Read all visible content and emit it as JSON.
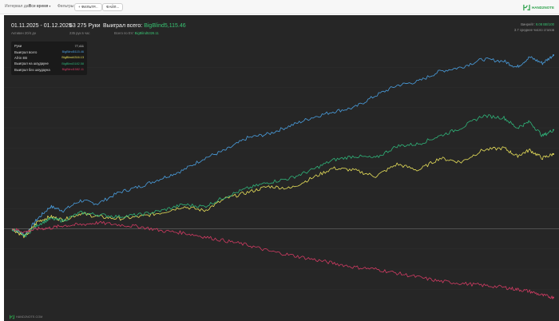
{
  "toolbar": {
    "interval_label": "Интервал дат:",
    "interval_value": "Все время",
    "filters_label": "Фильтры:",
    "filter_button": "+ ФИЛЬТР...",
    "file_button": "ФАЙЛ..."
  },
  "brand": {
    "name": "HAND2NOTE",
    "accent_color": "#2da14b"
  },
  "graph": {
    "date_range": "01.11.2025 - 01.12.2025",
    "active_days": "Активен 20/4 дн",
    "hands": "63 275 Руки",
    "hands_per_hour": "235 рук в час",
    "won_total_label": "Выиграл всего:",
    "won_total_value": "BigBlind5,115.46",
    "ev_label": "Всего по EV:",
    "ev_value": "BigBlind5326.11",
    "winrate_label": "Винрейт:",
    "winrate_value": "8.08 BB/100",
    "avg_tables": "3.7 среднее число столов",
    "footer_brand": "HAND2NOTE.COM"
  },
  "legend": {
    "rows": [
      {
        "label": "Руки",
        "value": "77,411",
        "color": "#dcdcdc"
      },
      {
        "label": "Выиграл всего",
        "value": "BigBlind5115.46",
        "color": "#4a9fe0"
      },
      {
        "label": "All-in EB",
        "value": "BigBlind4316.13",
        "color": "#e8e05a"
      },
      {
        "label": "Выиграл на шоудауне",
        "value": "BigBlind3182.58",
        "color": "#2fb57a"
      },
      {
        "label": "Выиграл без шоудауна",
        "value": "BigBlind1582.11",
        "color": "#d23b63"
      }
    ]
  },
  "chart_data": {
    "type": "line",
    "xlabel": "",
    "ylabel": "",
    "grid": true,
    "xlim": [
      0,
      63275
    ],
    "ylim": [
      -1800,
      4400
    ],
    "series": [
      {
        "name": "Выиграл всего",
        "color": "#4a9fe0",
        "x": [
          0,
          1500,
          3000,
          4500,
          6000,
          8000,
          10000,
          12500,
          15000,
          17500,
          20000,
          22500,
          25000,
          27500,
          30000,
          32500,
          35000,
          37500,
          40000,
          42500,
          45000,
          47500,
          50000,
          52500,
          55000,
          57500,
          59000,
          60500,
          62000,
          63275
        ],
        "y": [
          0,
          -150,
          250,
          550,
          450,
          700,
          620,
          900,
          1050,
          1250,
          1450,
          1750,
          1950,
          2250,
          2350,
          2550,
          2750,
          2900,
          3000,
          3300,
          3550,
          3650,
          3900,
          4000,
          4200,
          4150,
          4000,
          4250,
          4100,
          4300
        ]
      },
      {
        "name": "All-in EB",
        "color": "#e8e05a",
        "x": [
          0,
          1500,
          3000,
          4500,
          6000,
          8000,
          10000,
          12500,
          15000,
          17500,
          20000,
          22500,
          25000,
          27500,
          30000,
          32500,
          35000,
          37500,
          40000,
          42500,
          45000,
          47500,
          50000,
          52500,
          55000,
          57500,
          59000,
          60500,
          62000,
          63275
        ],
        "y": [
          0,
          -200,
          180,
          300,
          220,
          380,
          300,
          250,
          300,
          400,
          550,
          450,
          750,
          900,
          1050,
          1000,
          1250,
          1500,
          1450,
          1300,
          1600,
          1450,
          1750,
          1650,
          1950,
          2000,
          1800,
          1950,
          1750,
          1850
        ]
      },
      {
        "name": "Выиграл на шоудауне",
        "color": "#2fb57a",
        "x": [
          0,
          1500,
          3000,
          4500,
          6000,
          8000,
          10000,
          12500,
          15000,
          17500,
          20000,
          22500,
          25000,
          27500,
          30000,
          32500,
          35000,
          37500,
          40000,
          42500,
          45000,
          47500,
          50000,
          52500,
          55000,
          57500,
          59000,
          60500,
          62000,
          63275
        ],
        "y": [
          0,
          -180,
          100,
          250,
          200,
          400,
          350,
          300,
          350,
          450,
          600,
          550,
          800,
          1000,
          1150,
          1250,
          1450,
          1700,
          1800,
          1750,
          2050,
          2100,
          2300,
          2500,
          2800,
          2750,
          2500,
          2650,
          2300,
          2450
        ]
      },
      {
        "name": "Выиграл без шоудауна",
        "color": "#d23b63",
        "x": [
          0,
          1500,
          3000,
          4500,
          6000,
          8000,
          10000,
          12500,
          15000,
          17500,
          20000,
          22500,
          25000,
          27500,
          30000,
          32500,
          35000,
          37500,
          40000,
          42500,
          45000,
          47500,
          50000,
          52500,
          55000,
          57500,
          59000,
          60500,
          62000,
          63275
        ],
        "y": [
          0,
          -80,
          0,
          20,
          80,
          100,
          150,
          100,
          50,
          -50,
          -100,
          -200,
          -300,
          -400,
          -550,
          -650,
          -750,
          -850,
          -950,
          -1000,
          -1100,
          -1200,
          -1300,
          -1350,
          -1400,
          -1450,
          -1500,
          -1550,
          -1650,
          -1700
        ]
      }
    ]
  }
}
